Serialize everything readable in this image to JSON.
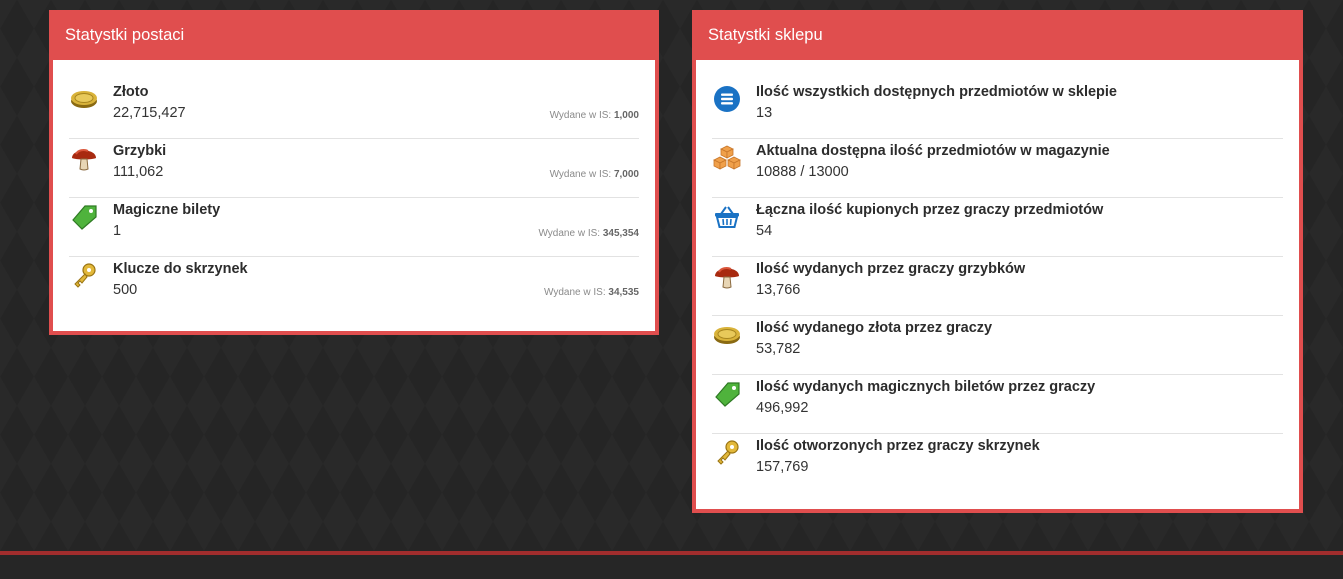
{
  "character_stats": {
    "title": "Statystki postaci",
    "spent_prefix": "Wydane w IS:",
    "items": [
      {
        "label": "Złoto",
        "value": "22,715,427",
        "spent": "1,000",
        "icon": "gold-coin-icon"
      },
      {
        "label": "Grzybki",
        "value": "111,062",
        "spent": "7,000",
        "icon": "mushroom-icon"
      },
      {
        "label": "Magiczne bilety",
        "value": "1",
        "spent": "345,354",
        "icon": "green-ticket-icon"
      },
      {
        "label": "Klucze do skrzynek",
        "value": "500",
        "spent": "34,535",
        "icon": "key-icon"
      }
    ]
  },
  "shop_stats": {
    "title": "Statystki sklepu",
    "items": [
      {
        "label": "Ilość wszystkich dostępnych przedmiotów w sklepie",
        "value": "13",
        "icon": "list-icon"
      },
      {
        "label": "Aktualna dostępna ilość przedmiotów w magazynie",
        "value": "10888 / 13000",
        "icon": "boxes-icon"
      },
      {
        "label": "Łączna ilość kupionych przez graczy przedmiotów",
        "value": "54",
        "icon": "basket-icon"
      },
      {
        "label": "Ilość wydanych przez graczy grzybków",
        "value": "13,766",
        "icon": "mushroom-icon"
      },
      {
        "label": "Ilość wydanego złota przez graczy",
        "value": "53,782",
        "icon": "gold-coin-icon"
      },
      {
        "label": "Ilość wydanych magicznych biletów przez graczy",
        "value": "496,992",
        "icon": "green-ticket-icon"
      },
      {
        "label": "Ilość otworzonych przez graczy skrzynek",
        "value": "157,769",
        "icon": "key-icon"
      }
    ]
  },
  "colors": {
    "accent": "#e04e4e",
    "background": "#252525",
    "footer_border": "#a12d2d"
  }
}
